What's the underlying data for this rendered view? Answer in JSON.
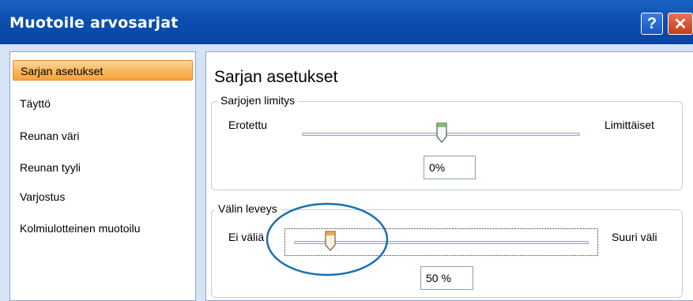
{
  "window": {
    "title": "Muotoile arvosarjat",
    "help": "?",
    "close": "✕"
  },
  "sidebar": {
    "items": [
      {
        "label": "Sarjan asetukset",
        "active": true
      },
      {
        "label": "Täyttö"
      },
      {
        "label": "Reunan väri"
      },
      {
        "label": "Reunan tyyli"
      },
      {
        "label": "Varjostus"
      },
      {
        "label": "Kolmiulotteinen muotoilu"
      }
    ]
  },
  "content": {
    "title": "Sarjan asetukset",
    "overlap": {
      "label": "Sarjojen limitys",
      "min_label": "Erotettu",
      "max_label": "Limittäiset",
      "value": "0%",
      "slider_fraction": 0.5
    },
    "gap": {
      "label": "Välin leveys",
      "min_label": "Ei väliä",
      "max_label": "Suuri väli",
      "value": "50 %",
      "slider_fraction": 0.1
    }
  },
  "colors": {
    "titlebar": "#0b4fb0",
    "active_item": "#f9b95e",
    "annotation_circle": "#1a6fb0"
  }
}
